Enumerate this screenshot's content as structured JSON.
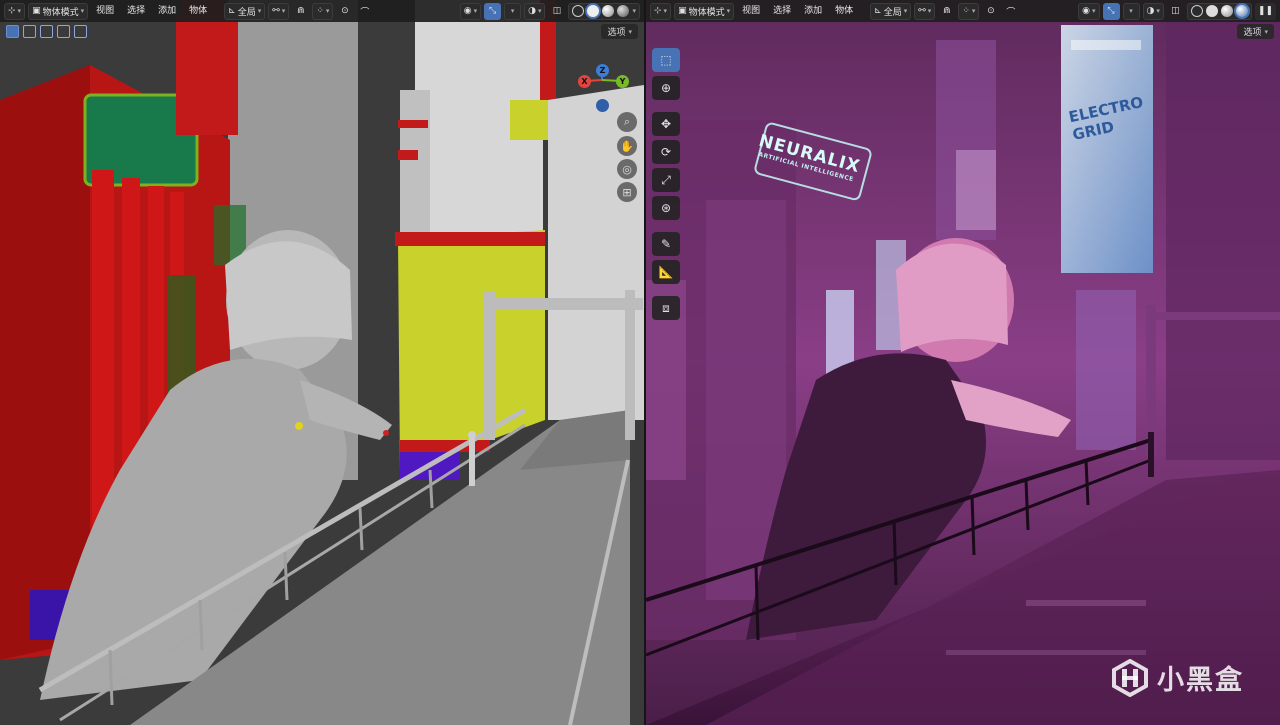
{
  "left_viewport": {
    "header": {
      "mode_label": "物体模式",
      "menu": [
        "视图",
        "选择",
        "添加",
        "物体"
      ],
      "transform_label": "全局"
    },
    "options_label": "选项",
    "gizmo": {
      "x_label": "X",
      "y_label": "Y",
      "z_label": "Z"
    }
  },
  "right_viewport": {
    "header": {
      "mode_label": "物体模式",
      "menu": [
        "视图",
        "选择",
        "添加",
        "物体"
      ],
      "transform_label": "全局"
    },
    "options_label": "选项",
    "pause_icon": "pause-icon"
  },
  "scene_signs": {
    "neuralix_title": "NEURALIX",
    "neuralix_sub": "ARTIFICIAL INTELLIGENCE",
    "billboard_line1": "ELECTRO",
    "billboard_line2": "GRID"
  },
  "watermark": {
    "text": "小黑盒"
  },
  "colors": {
    "accent_blue": "#4772b3",
    "axis_x": "#e2453f",
    "axis_y": "#78bb26",
    "axis_z": "#3a7ed8",
    "neon_magenta": "#c24fa8"
  }
}
